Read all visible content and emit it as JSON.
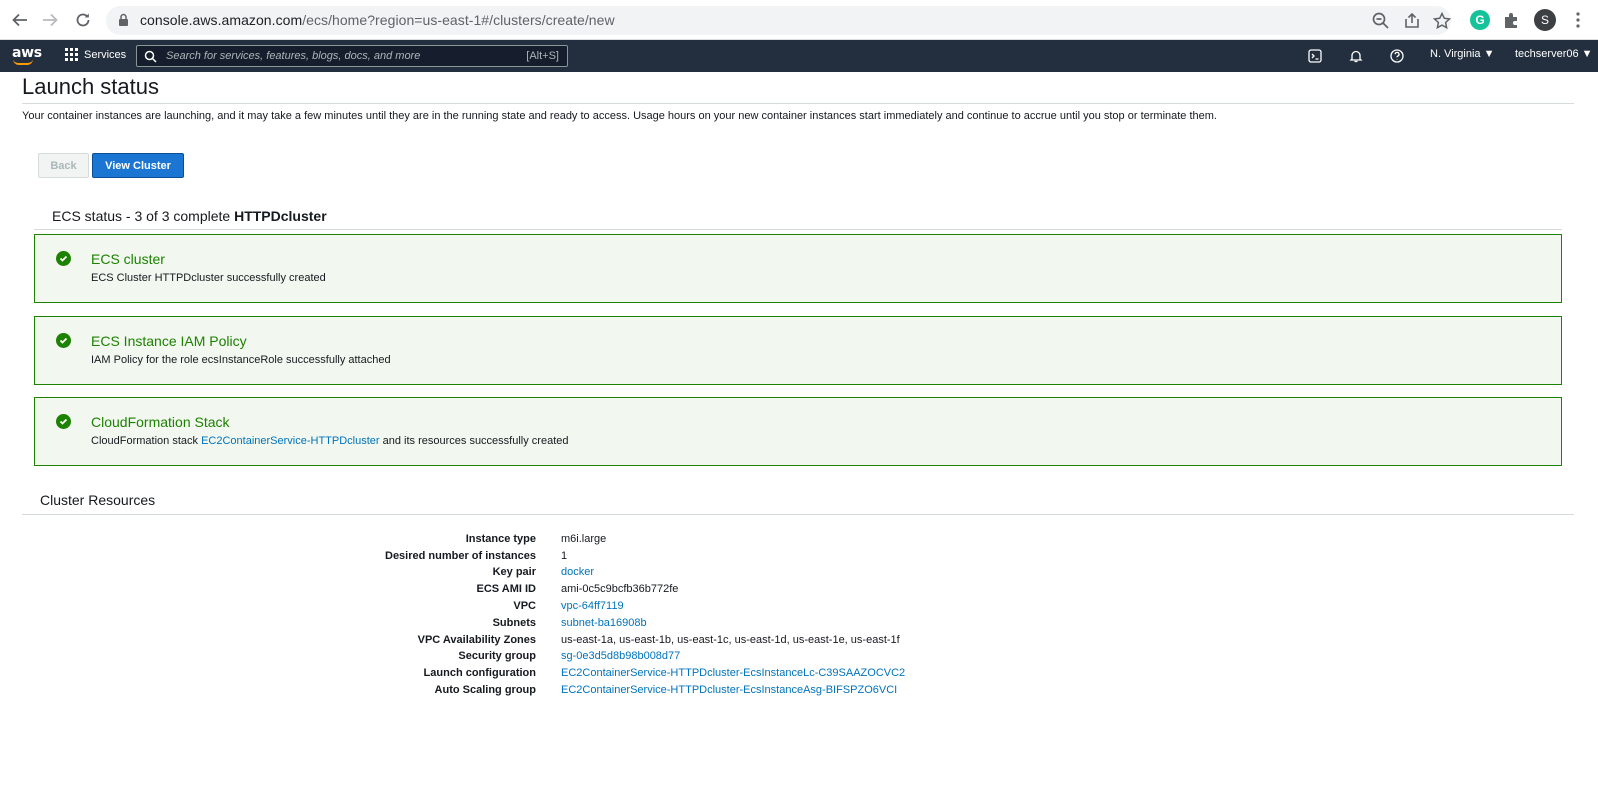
{
  "browser": {
    "url_host": "console.aws.amazon.com",
    "url_path": "/ecs/home?region=us-east-1#/clusters/create/new",
    "profile_initial": "S"
  },
  "aws_nav": {
    "logo": "aws",
    "services_label": "Services",
    "search_placeholder": "Search for services, features, blogs, docs, and more",
    "search_shortcut": "[Alt+S]",
    "region": "N. Virginia",
    "account": "techserver06"
  },
  "page": {
    "title": "Launch status",
    "intro": "Your container instances are launching, and it may take a few minutes until they are in the running state and ready to access. Usage hours on your new container instances start immediately and continue to accrue until you stop or terminate them.",
    "back_label": "Back",
    "view_cluster_label": "View Cluster"
  },
  "ecs_status": {
    "prefix": "ECS status - 3 of 3 complete",
    "cluster_name": "HTTPDcluster",
    "items": [
      {
        "title": "ECS cluster",
        "desc": "ECS Cluster HTTPDcluster successfully created"
      },
      {
        "title": "ECS Instance IAM Policy",
        "desc": "IAM Policy for the role ecsInstanceRole successfully attached"
      },
      {
        "title": "CloudFormation Stack",
        "desc_before": "CloudFormation stack",
        "desc_link": "EC2ContainerService-HTTPDcluster",
        "desc_after": "and its resources successfully created"
      }
    ]
  },
  "cluster_resources": {
    "title": "Cluster Resources",
    "rows": [
      {
        "key": "Instance type",
        "value": "m6i.large"
      },
      {
        "key": "Desired number of instances",
        "value": "1"
      },
      {
        "key": "Key pair",
        "value": "docker"
      },
      {
        "key": "ECS AMI ID",
        "value": "ami-0c5c9bcfb36b772fe"
      },
      {
        "key": "VPC",
        "value": "vpc-64ff7119"
      },
      {
        "key": "Subnets",
        "value": "subnet-ba16908b"
      },
      {
        "key": "VPC Availability Zones",
        "value": "us-east-1a, us-east-1b, us-east-1c, us-east-1d, us-east-1e, us-east-1f"
      },
      {
        "key": "Security group",
        "value": "sg-0e3d5d8b98b008d77"
      },
      {
        "key": "Launch configuration",
        "value": "EC2ContainerService-HTTPDcluster-EcsInstanceLc-C39SAAZOCVC2"
      },
      {
        "key": "Auto Scaling group",
        "value": "EC2ContainerService-HTTPDcluster-EcsInstanceAsg-BIFSPZO6VCI"
      }
    ]
  }
}
